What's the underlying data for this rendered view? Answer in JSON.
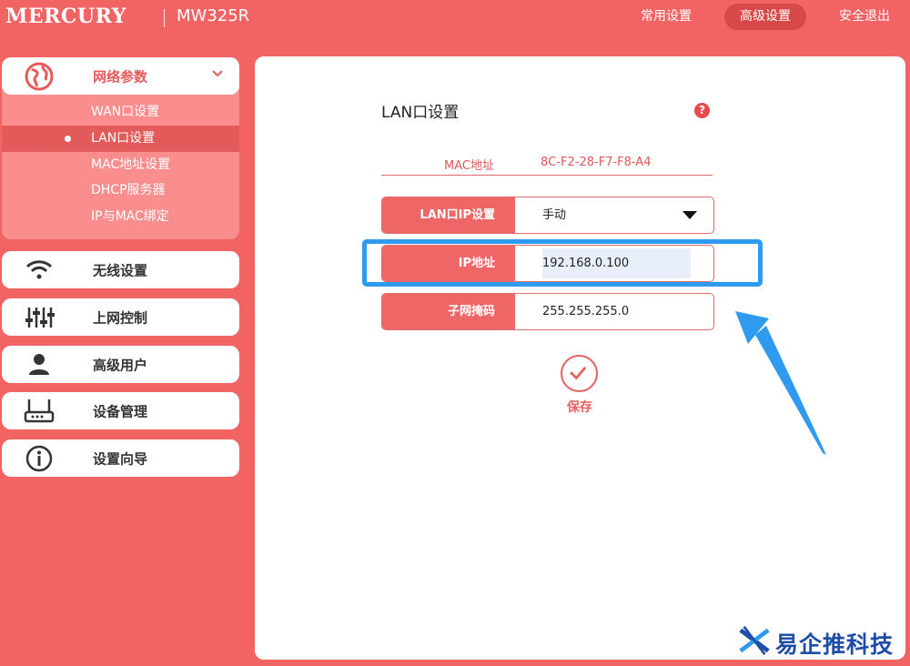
{
  "header": {
    "brand": "MERCURY",
    "model": "MW325R",
    "nav": {
      "common": "常用设置",
      "advanced": "高级设置",
      "logout": "安全退出"
    }
  },
  "sidebar": {
    "network": {
      "label": "网络参数",
      "icon": "globe-icon",
      "items": [
        "WAN口设置",
        "LAN口设置",
        "MAC地址设置",
        "DHCP服务器",
        "IP与MAC绑定"
      ],
      "active_index": 1
    },
    "wireless": {
      "label": "无线设置",
      "icon": "wifi-icon"
    },
    "access": {
      "label": "上网控制",
      "icon": "sliders-icon"
    },
    "users": {
      "label": "高级用户",
      "icon": "user-icon"
    },
    "device": {
      "label": "设备管理",
      "icon": "router-icon"
    },
    "wizard": {
      "label": "设置向导",
      "icon": "info-icon"
    }
  },
  "main": {
    "title": "LAN口设置",
    "help": "?",
    "mac": {
      "label": "MAC地址",
      "value": "8C-F2-28-F7-F8-A4"
    },
    "mode": {
      "label": "LAN口IP设置",
      "value": "手动"
    },
    "ip": {
      "label": "IP地址",
      "value": "192.168.0.100"
    },
    "mask": {
      "label": "子网掩码",
      "value": "255.255.255.0"
    },
    "save_label": "保存"
  },
  "annotation": {
    "color": "#2f9bf0"
  },
  "watermark": {
    "text": "易企推科技"
  },
  "colors": {
    "brand": "#f26464",
    "accent_dark": "#e25a5a",
    "text_red": "#e05858"
  }
}
